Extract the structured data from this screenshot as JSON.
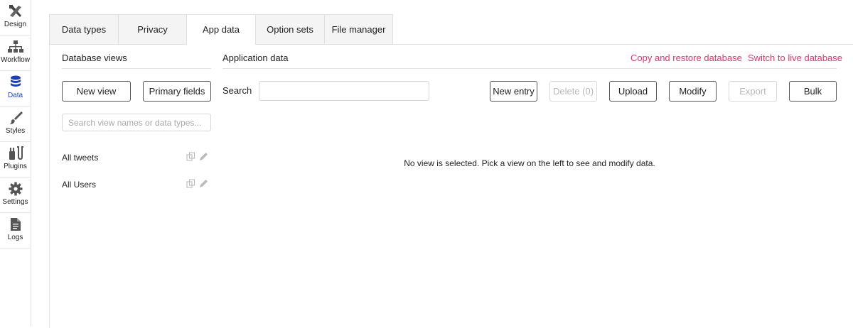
{
  "sidebar": {
    "items": [
      {
        "label": "Design",
        "icon": "design-icon"
      },
      {
        "label": "Workflow",
        "icon": "workflow-icon"
      },
      {
        "label": "Data",
        "icon": "database-icon",
        "active": true
      },
      {
        "label": "Styles",
        "icon": "brush-icon"
      },
      {
        "label": "Plugins",
        "icon": "plug-icon"
      },
      {
        "label": "Settings",
        "icon": "gear-icon"
      },
      {
        "label": "Logs",
        "icon": "document-icon"
      }
    ]
  },
  "tabs": [
    {
      "label": "Data types"
    },
    {
      "label": "Privacy"
    },
    {
      "label": "App data",
      "active": true
    },
    {
      "label": "Option sets"
    },
    {
      "label": "File manager"
    }
  ],
  "left": {
    "title": "Database views",
    "new_view": "New view",
    "primary_fields": "Primary fields",
    "search_placeholder": "Search view names or data types...",
    "views": [
      {
        "name": "All tweets"
      },
      {
        "name": "All Users"
      }
    ]
  },
  "main": {
    "title": "Application data",
    "copy_restore": "Copy and restore database",
    "switch_live": "Switch to live database",
    "search_label": "Search",
    "search_value": "",
    "buttons": {
      "new_entry": "New entry",
      "delete": "Delete (0)",
      "upload": "Upload",
      "modify": "Modify",
      "export": "Export",
      "bulk": "Bulk"
    },
    "empty_message": "No view is selected. Pick a view on the left to see and modify data."
  },
  "colors": {
    "accent_link": "#e6336b",
    "active_nav": "#1d3fb8",
    "disabled_text": "#b8b8b8"
  }
}
